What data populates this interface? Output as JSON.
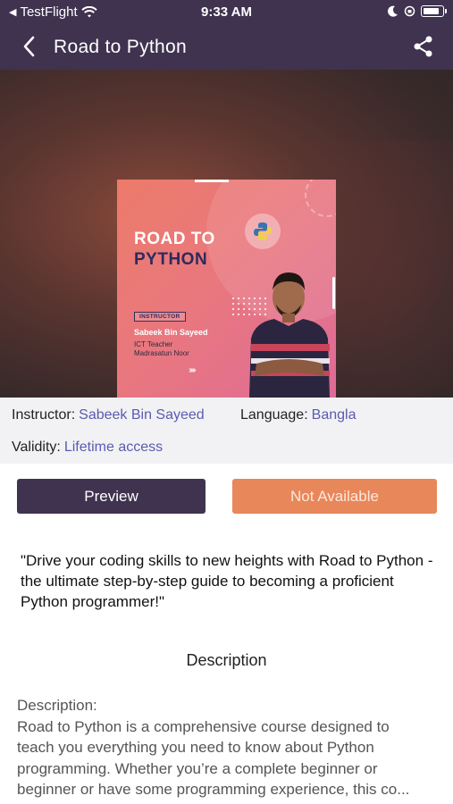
{
  "status_bar": {
    "back_app": "TestFlight",
    "time": "9:33 AM"
  },
  "nav": {
    "title": "Road to Python",
    "back_icon": "chevron-left-icon",
    "share_icon": "share-icon"
  },
  "poster": {
    "title_line1": "ROAD TO",
    "title_line2": "PYTHON",
    "badge": "INSTRUCTOR",
    "name": "Sabeek Bin Sayeed",
    "role_line1": "ICT Teacher",
    "role_line2": "Madrasatun Noor",
    "arrows": "›››››"
  },
  "info": {
    "instructor_label": "Instructor:",
    "instructor_value": "Sabeek Bin Sayeed",
    "language_label": "Language:",
    "language_value": "Bangla",
    "validity_label": "Validity:",
    "validity_value": "Lifetime access"
  },
  "buttons": {
    "preview": "Preview",
    "not_available": "Not Available"
  },
  "quote": "\"Drive your coding skills to new heights with Road to Python - the ultimate step-by-step guide to becoming a proficient Python programmer!\"",
  "description": {
    "heading": "Description",
    "lines": [
      "Description:",
      "Road to Python is a comprehensive course designed to",
      "teach you everything you need to know about Python",
      "programming. Whether you’re a complete beginner or",
      " beginner or have some programming experience, this co..."
    ]
  },
  "colors": {
    "header_bg": "#3f3350",
    "accent_link": "#5b5bb0",
    "preview_button": "#3f3350",
    "not_available_button": "#e8875a"
  }
}
